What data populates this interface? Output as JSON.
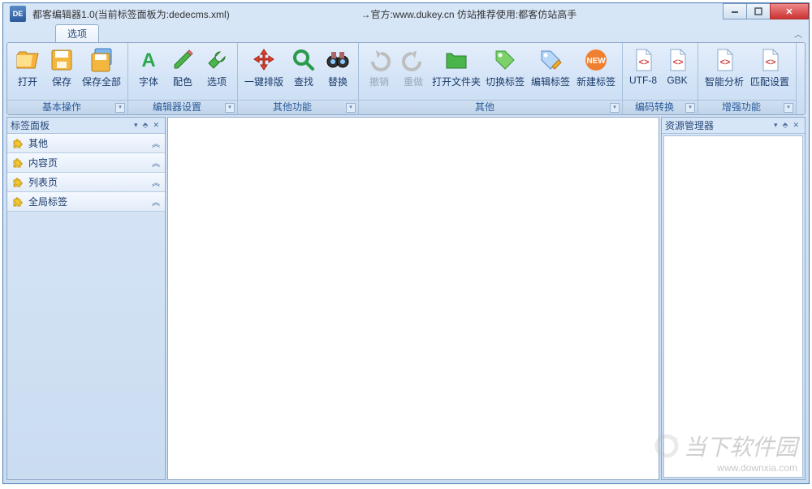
{
  "titlebar": {
    "app_icon_text": "DE",
    "title": "都客编辑器1.0(当前标签面板为:dedecms.xml)",
    "center_text": "→官方:www.dukey.cn 仿站推荐使用:都客仿站高手"
  },
  "tabs": {
    "options": "选项"
  },
  "ribbon": {
    "groups": [
      {
        "label": "基本操作",
        "buttons": [
          {
            "id": "open",
            "label": "打开",
            "icon": "folder-open"
          },
          {
            "id": "save",
            "label": "保存",
            "icon": "save"
          },
          {
            "id": "saveall",
            "label": "保存全部",
            "icon": "save-all",
            "wide": true
          }
        ]
      },
      {
        "label": "编辑器设置",
        "buttons": [
          {
            "id": "font",
            "label": "字体",
            "icon": "font"
          },
          {
            "id": "color",
            "label": "配色",
            "icon": "pencil"
          },
          {
            "id": "opts",
            "label": "选项",
            "icon": "wrench"
          }
        ]
      },
      {
        "label": "其他功能",
        "buttons": [
          {
            "id": "layout",
            "label": "一键排版",
            "icon": "arrows",
            "wide": true
          },
          {
            "id": "find",
            "label": "查找",
            "icon": "search"
          },
          {
            "id": "replace",
            "label": "替换",
            "icon": "binoculars"
          }
        ]
      },
      {
        "label": "其他",
        "buttons": [
          {
            "id": "undo",
            "label": "撤销",
            "icon": "undo",
            "disabled": true
          },
          {
            "id": "redo",
            "label": "重做",
            "icon": "redo",
            "disabled": true
          },
          {
            "id": "openfolder",
            "label": "打开文件夹",
            "icon": "folder-green",
            "wide": true
          },
          {
            "id": "switchtag",
            "label": "切换标签",
            "icon": "tag-green",
            "wide": true
          },
          {
            "id": "edittag",
            "label": "编辑标签",
            "icon": "tag-edit",
            "wide": true
          },
          {
            "id": "newtag",
            "label": "新建标签",
            "icon": "new",
            "wide": true
          }
        ]
      },
      {
        "label": "编码转换",
        "buttons": [
          {
            "id": "utf8",
            "label": "UTF-8",
            "icon": "doc-code"
          },
          {
            "id": "gbk",
            "label": "GBK",
            "icon": "doc-code"
          }
        ]
      },
      {
        "label": "增强功能",
        "buttons": [
          {
            "id": "smart",
            "label": "智能分析",
            "icon": "doc-code",
            "wide": true
          },
          {
            "id": "match",
            "label": "匹配设置",
            "icon": "doc-code",
            "wide": true
          }
        ]
      }
    ]
  },
  "left_panel": {
    "title": "标签面板",
    "items": [
      "其他",
      "内容页",
      "列表页",
      "全局标签"
    ]
  },
  "right_panel": {
    "title": "资源管理器"
  },
  "watermark": {
    "site": "当下软件园",
    "url": "www.downxia.com"
  }
}
